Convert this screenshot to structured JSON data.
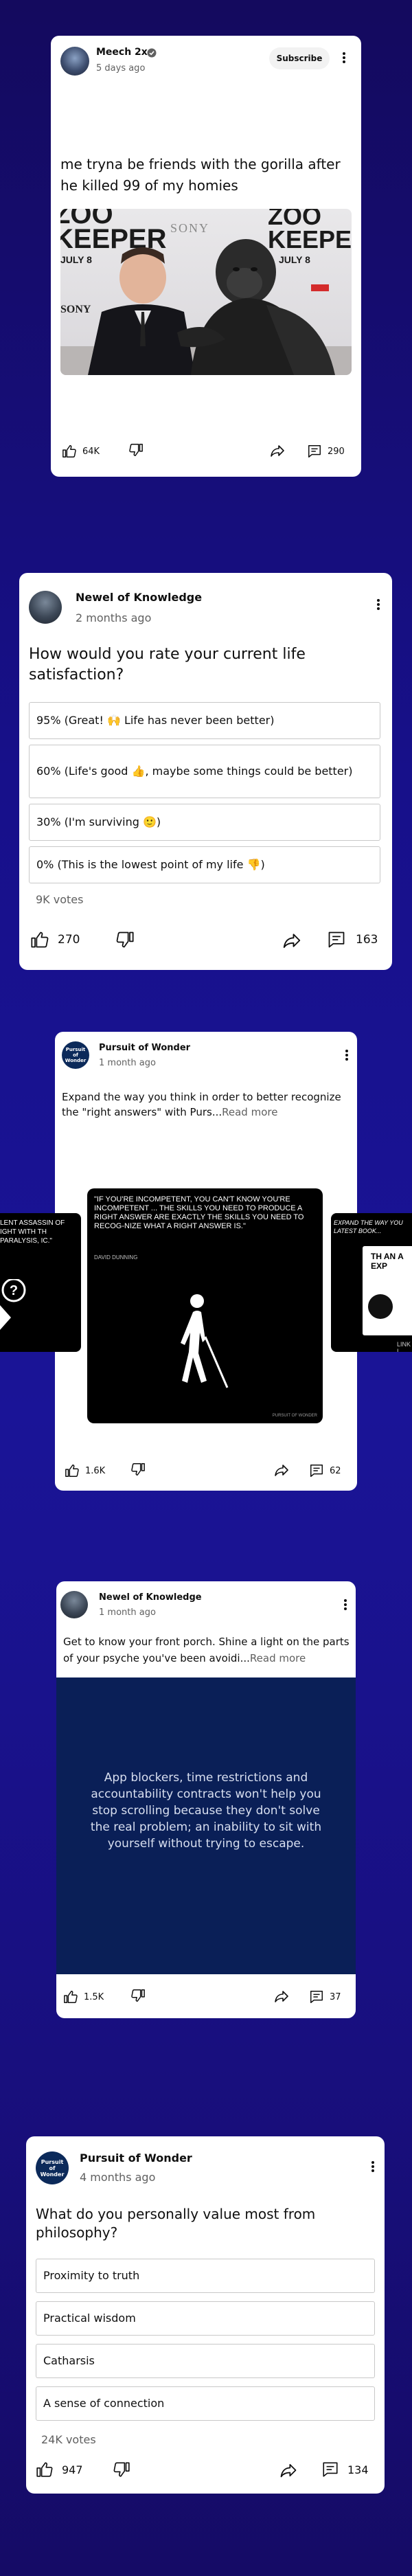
{
  "post1": {
    "channel": "Meech 2x",
    "time": "5 days ago",
    "subscribe_label": "Subscribe",
    "text": "me tryna be friends with the gorilla after he killed 99 of my homies",
    "image": {
      "title_left": "ZOO KEEPER",
      "title_right": "ZOO KEEPER",
      "date_left": "JULY 8",
      "date_right": "JULY 8",
      "brand_left": "SONY",
      "brand_top": "SONY"
    },
    "likes": "64K",
    "comments": "290"
  },
  "post2": {
    "channel": "Newel of Knowledge",
    "time": "2 months ago",
    "question": "How would you rate your current life satisfaction?",
    "options": [
      "95% (Great! 🙌 Life has never been better)",
      "60% (Life's good 👍, maybe some things could be better)",
      "30% (I'm surviving 🙂)",
      "0% (This is the lowest point of my life 👎)"
    ],
    "votes": "9K votes",
    "likes": "270",
    "comments": "163"
  },
  "post3": {
    "channel": "Pursuit of Wonder",
    "avatar_text": "Pursuit of Wonder",
    "time": "1 month ago",
    "text": "Expand the way you think in order to better recognize the \"right answers\" with Purs...",
    "read_more": "Read more",
    "left_slide_text": "LENT ASSASSIN OF IGHT WITH TH PARALYSIS, IC.\"",
    "quote": "\"IF YOU'RE INCOMPETENT, YOU CAN'T KNOW YOU'RE INCOMPETENT ... THE SKILLS YOU NEED TO PRODUCE A RIGHT ANSWER ARE EXACTLY THE SKILLS YOU NEED TO RECOG-NIZE WHAT A RIGHT ANSWER IS.\"",
    "author": "DAVID DUNNING",
    "watermark": "PURSUIT OF WONDER",
    "right_slide_text": "EXPAND THE WAY YOU LATEST BOOK...",
    "right_slide_book": "TH AN A EXP",
    "right_slide_link": "LINK I",
    "likes": "1.6K",
    "comments": "62"
  },
  "post4": {
    "channel": "Newel of Knowledge",
    "time": "1 month ago",
    "text": "Get to know your front porch. Shine a light on the parts of your psyche you've been avoidi...",
    "read_more": "Read more",
    "image_text": "App blockers, time restrictions and accountability contracts won't help you stop scrolling because they don't solve the real problem; an inability to sit with yourself without trying to escape.",
    "likes": "1.5K",
    "comments": "37"
  },
  "post5": {
    "channel": "Pursuit of Wonder",
    "avatar_text": "Pursuit of Wonder",
    "time": "4 months ago",
    "question": "What do you personally value most from philosophy?",
    "options": [
      "Proximity to truth",
      "Practical wisdom",
      "Catharsis",
      "A sense of connection"
    ],
    "votes": "24K votes",
    "likes": "947",
    "comments": "134"
  }
}
